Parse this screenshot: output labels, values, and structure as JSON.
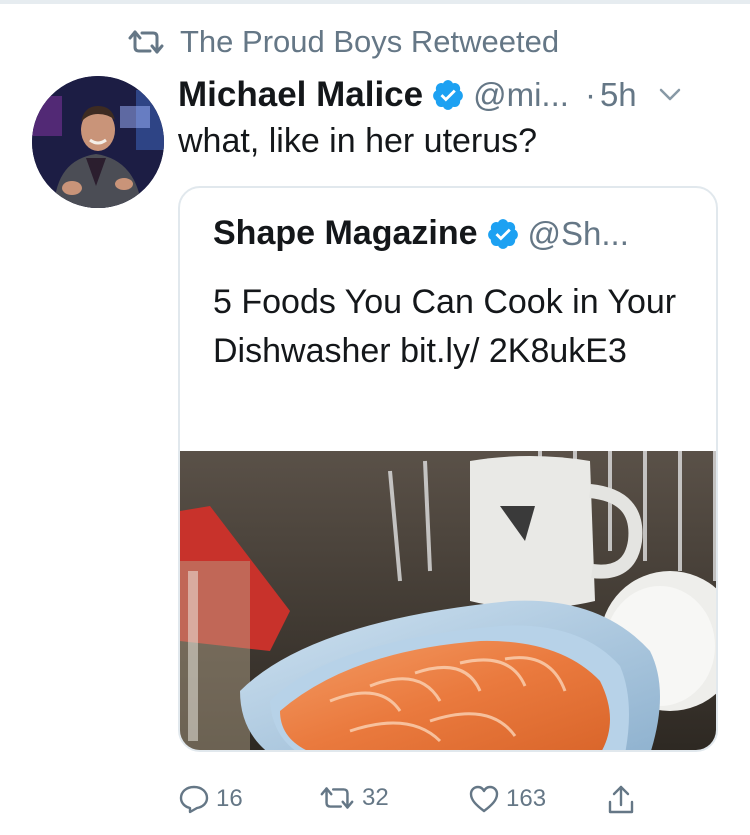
{
  "retweet_banner": {
    "text": "The Proud Boys Retweeted",
    "icon": "retweet-icon"
  },
  "tweet": {
    "author_name": "Michael Malice",
    "handle": "@mi...",
    "separator": "·",
    "time": "5h",
    "text": "what, like in her uterus?",
    "verified": true
  },
  "quoted_tweet": {
    "author_name": "Shape Magazine",
    "handle": "@Sh...",
    "text": "5 Foods You Can Cook in Your Dishwasher bit.ly/ 2K8ukE3",
    "verified": true,
    "image_description_icon": "salmon-in-dishwasher-image"
  },
  "actions": {
    "reply_count": "16",
    "retweet_count": "32",
    "like_count": "163"
  },
  "colors": {
    "accent": "#1da1f2",
    "muted": "#657786",
    "text": "#14171a",
    "border": "#e1e8ed"
  }
}
